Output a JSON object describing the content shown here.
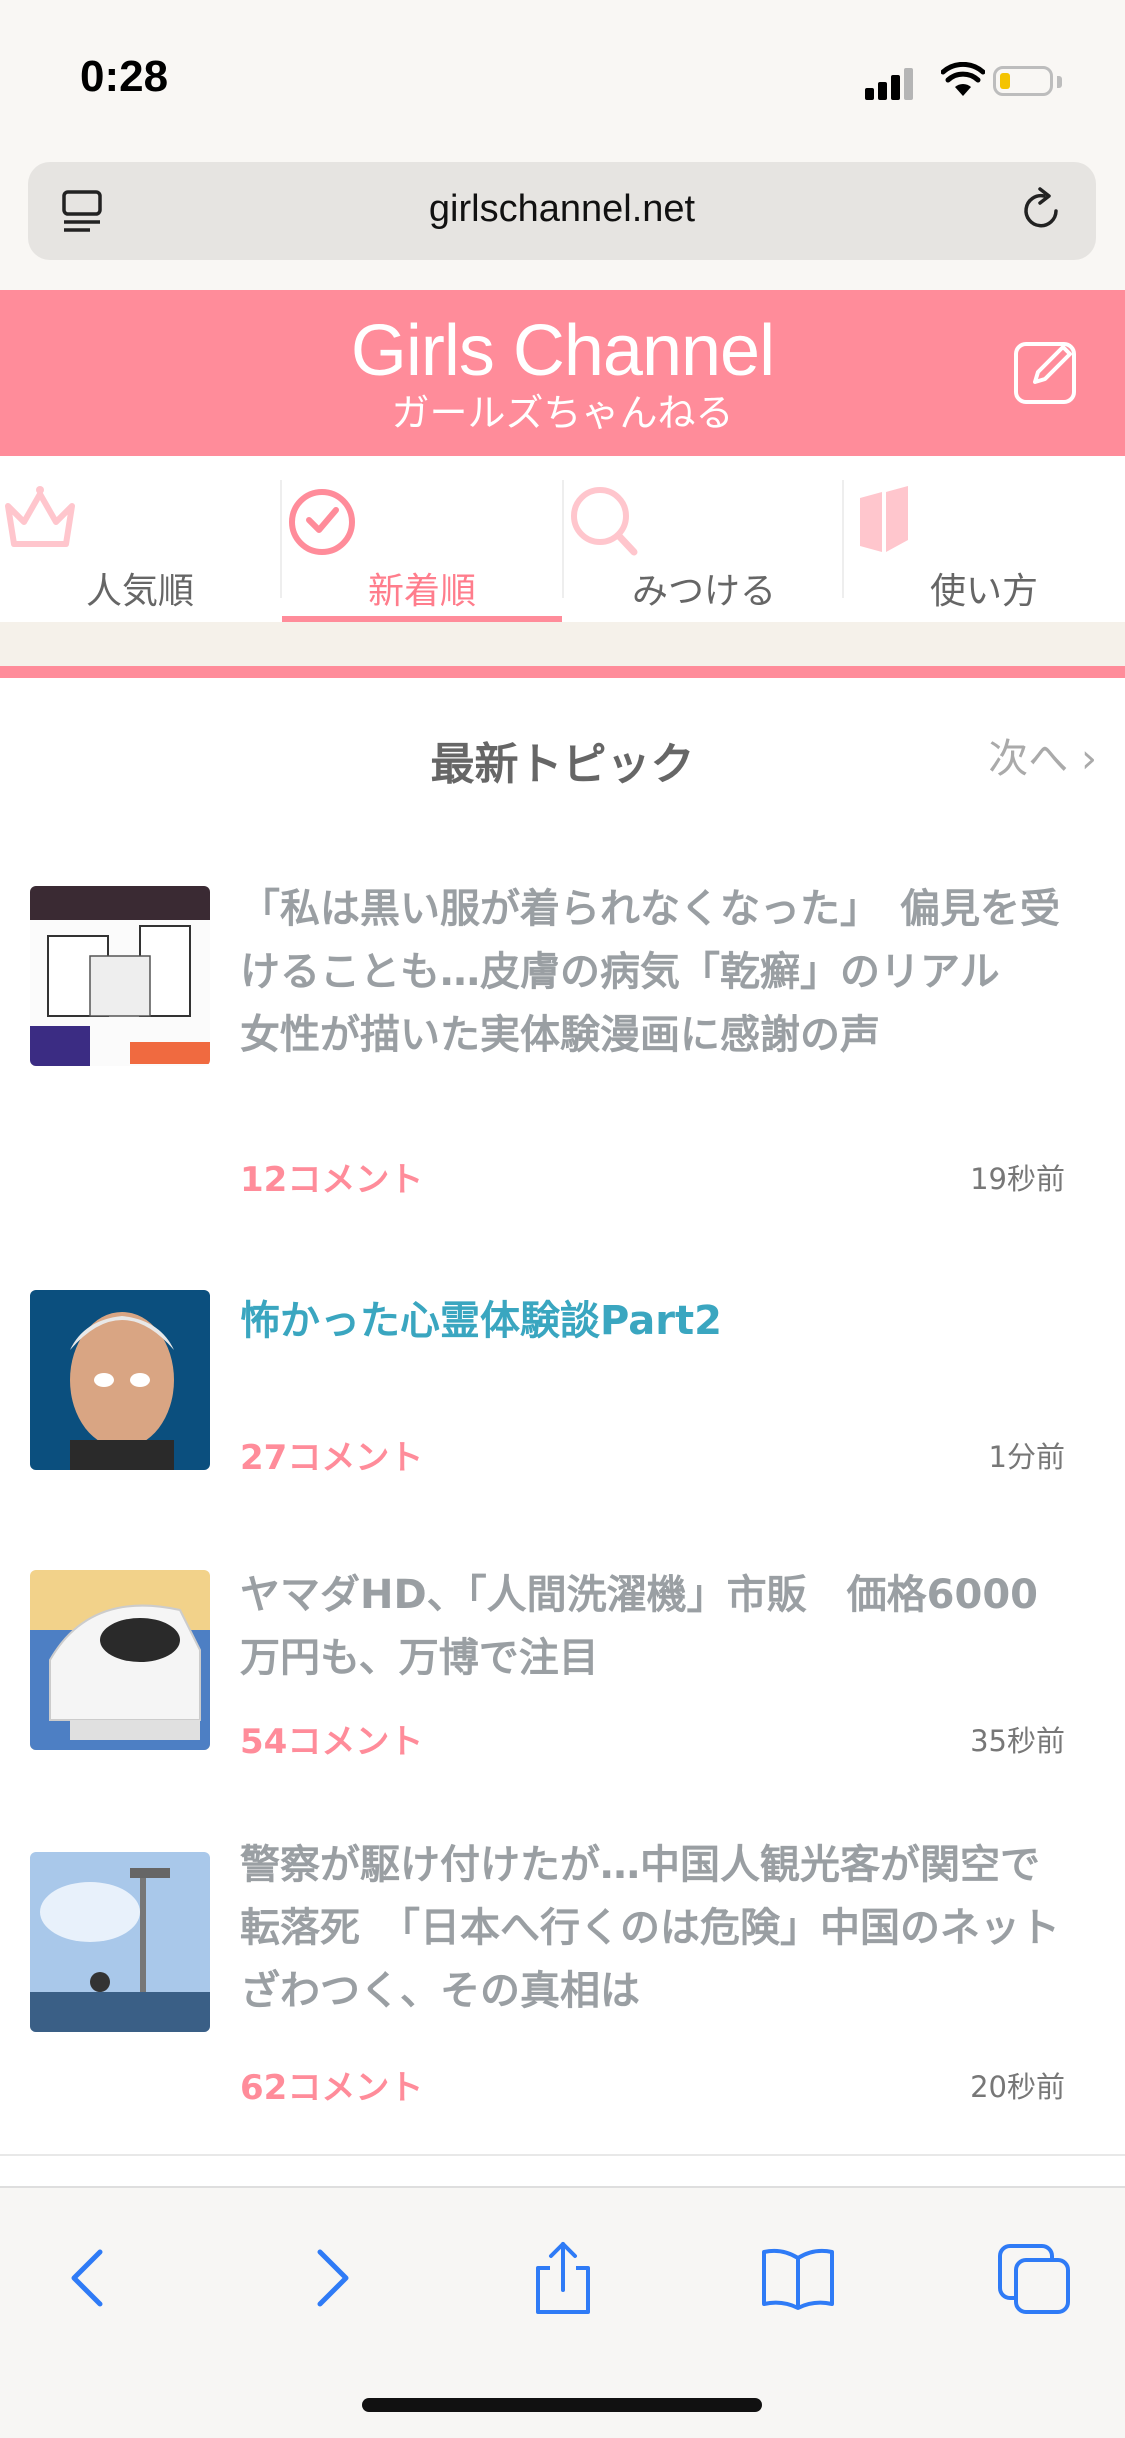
{
  "status_bar": {
    "time": "0:28"
  },
  "browser": {
    "url": "girlschannel.net"
  },
  "site": {
    "logo": "Girls Channel",
    "logo_sub": "ガールズちゃんねる"
  },
  "nav": {
    "tabs": [
      {
        "label": "人気順",
        "icon": "crown-icon",
        "active": false
      },
      {
        "label": "新着順",
        "icon": "clock-icon",
        "active": true
      },
      {
        "label": "みつける",
        "icon": "search-icon",
        "active": false
      },
      {
        "label": "使い方",
        "icon": "book-icon",
        "active": false
      }
    ]
  },
  "section": {
    "title": "最新トピック",
    "next": "次へ"
  },
  "topics": [
    {
      "title": "「私は黒い服が着られなくなった」　偏見を受けることも…皮膚の病気「乾癬」のリアル　女性が描いた実体験漫画に感謝の声",
      "comments": "12コメント",
      "time": "19秒前",
      "is_new": false
    },
    {
      "title": "怖かった心霊体験談Part2",
      "comments": "27コメント",
      "time": "1分前",
      "is_new": true
    },
    {
      "title": "ヤマダHD、「人間洗濯機」市販　価格6000万円も、万博で注目",
      "comments": "54コメント",
      "time": "35秒前",
      "is_new": false
    },
    {
      "title": "警察が駆け付けたが…中国人観光客が関空で転落死　「日本へ行くのは危険」中国のネットざわつく、その真相は",
      "comments": "62コメント",
      "time": "20秒前",
      "is_new": false
    }
  ],
  "toolbar": {
    "buttons": [
      "back-icon",
      "forward-icon",
      "share-icon",
      "bookmarks-icon",
      "tabs-icon"
    ]
  },
  "colors": {
    "brand_pink": "#ff8c9a",
    "new_topic_blue": "#3aa6c0",
    "toolbar_blue": "#2f7bf6"
  }
}
